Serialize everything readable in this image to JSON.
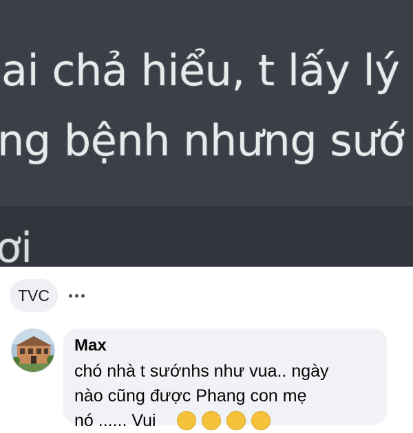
{
  "screenshot": {
    "line_1": "ai chả hiểu, t lấy lý",
    "line_2": "ng bệnh nhưng sướ",
    "line_3": "ơi"
  },
  "post": {
    "tag_label": "TVC"
  },
  "comment": {
    "author": "Max",
    "lines": [
      "chó nhà t sướnhs như vua.. ngày",
      "nào cũng được Phang con mẹ",
      "nó ...... Vui"
    ],
    "emoji_count": 4
  },
  "colors": {
    "dark_bg": "#3b4048",
    "dark_bg_lower": "#31353b",
    "bubble_bg": "#f0f2f5",
    "chip_bg": "#eef0f3",
    "text": "#050505",
    "emoji": "#f5c33b"
  },
  "icons": {
    "more": "more-dots-icon",
    "avatar": "profile-avatar",
    "emoji": "laughing-emoji-icon"
  }
}
